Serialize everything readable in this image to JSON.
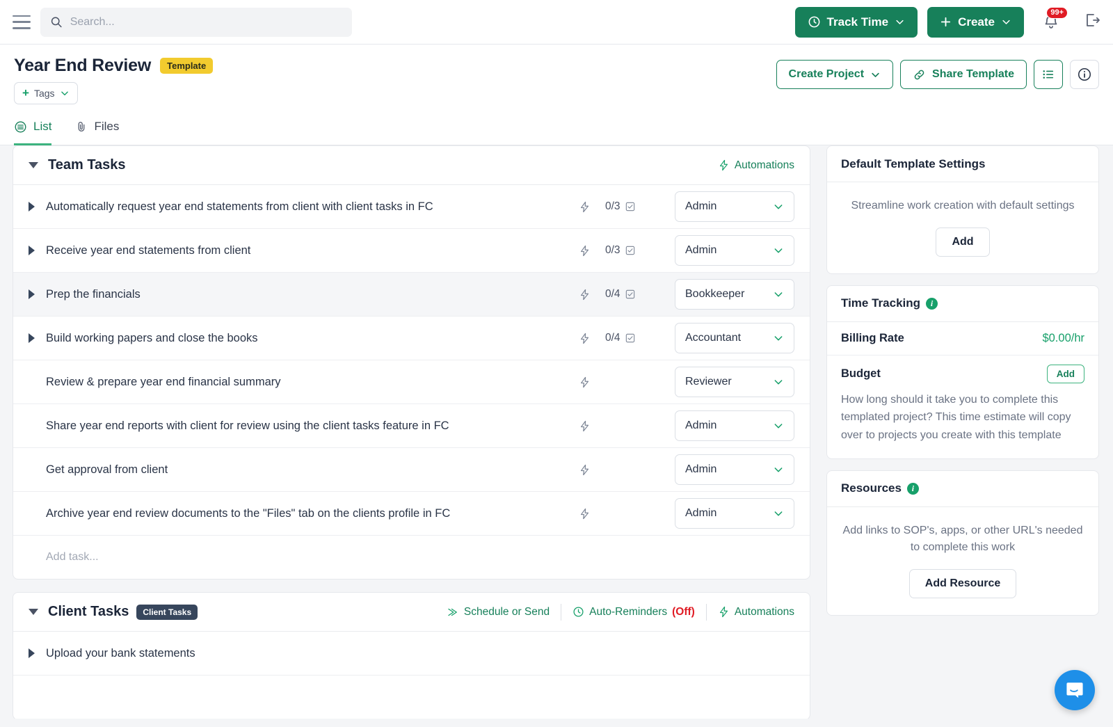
{
  "topbar": {
    "menu_icon": "hamburger-icon",
    "search": {
      "placeholder": "Search...",
      "value": ""
    },
    "track_time_label": "Track Time",
    "create_label": "Create",
    "notification_count": "99+"
  },
  "header": {
    "title": "Year End Review",
    "template_badge": "Template",
    "tags_label": "Tags",
    "create_project_label": "Create Project",
    "share_template_label": "Share Template"
  },
  "tabs": [
    {
      "label": "List",
      "icon": "list-icon",
      "active": true
    },
    {
      "label": "Files",
      "icon": "paperclip-icon",
      "active": false
    }
  ],
  "team_tasks": {
    "title": "Team Tasks",
    "automations_label": "Automations",
    "add_task_placeholder": "Add task...",
    "rows": [
      {
        "name": "Automatically request year end statements from client with client tasks in FC",
        "expandable": true,
        "subtasks": "0/3",
        "assignee": "Admin"
      },
      {
        "name": "Receive year end statements from client",
        "expandable": true,
        "subtasks": "0/3",
        "assignee": "Admin"
      },
      {
        "name": "Prep the financials",
        "expandable": true,
        "subtasks": "0/4",
        "assignee": "Bookkeeper",
        "highlight": true
      },
      {
        "name": "Build working papers and close the books",
        "expandable": true,
        "subtasks": "0/4",
        "assignee": "Accountant"
      },
      {
        "name": "Review & prepare year end financial summary",
        "expandable": false,
        "subtasks": "",
        "assignee": "Reviewer"
      },
      {
        "name": "Share year end reports with client for review using the client tasks feature in FC",
        "expandable": false,
        "subtasks": "",
        "assignee": "Admin"
      },
      {
        "name": "Get approval from client",
        "expandable": false,
        "subtasks": "",
        "assignee": "Admin"
      },
      {
        "name": "Archive year end review documents to the \"Files\" tab on the clients profile in FC",
        "expandable": false,
        "subtasks": "",
        "assignee": "Admin"
      }
    ]
  },
  "client_tasks": {
    "title": "Client Tasks",
    "chip": "Client Tasks",
    "schedule_label": "Schedule or Send",
    "auto_reminders_label": "Auto-Reminders",
    "auto_reminders_state": "(Off)",
    "automations_label": "Automations",
    "rows": [
      {
        "name": "Upload your bank statements",
        "expandable": true
      }
    ]
  },
  "sidebar": {
    "default_template_settings": {
      "title": "Default Template Settings",
      "description": "Streamline work creation with default settings",
      "add_label": "Add"
    },
    "time_tracking": {
      "title": "Time Tracking",
      "billing_rate_label": "Billing Rate",
      "billing_rate_value": "$0.00/hr",
      "budget_label": "Budget",
      "budget_add_label": "Add",
      "budget_description": "How long should it take you to complete this templated project? This time estimate will copy over to projects you create with this template"
    },
    "resources": {
      "title": "Resources",
      "description": "Add links to SOP's, apps, or other URL's needed to complete this work",
      "add_resource_label": "Add Resource"
    }
  },
  "chat": {
    "icon": "chat-bubble-icon"
  },
  "colors": {
    "primary_green": "#17805a",
    "accent_green": "#17a06a",
    "badge_yellow": "#f2cb2e",
    "alert_red": "#e01b24",
    "chat_blue": "#1e8fe8"
  }
}
